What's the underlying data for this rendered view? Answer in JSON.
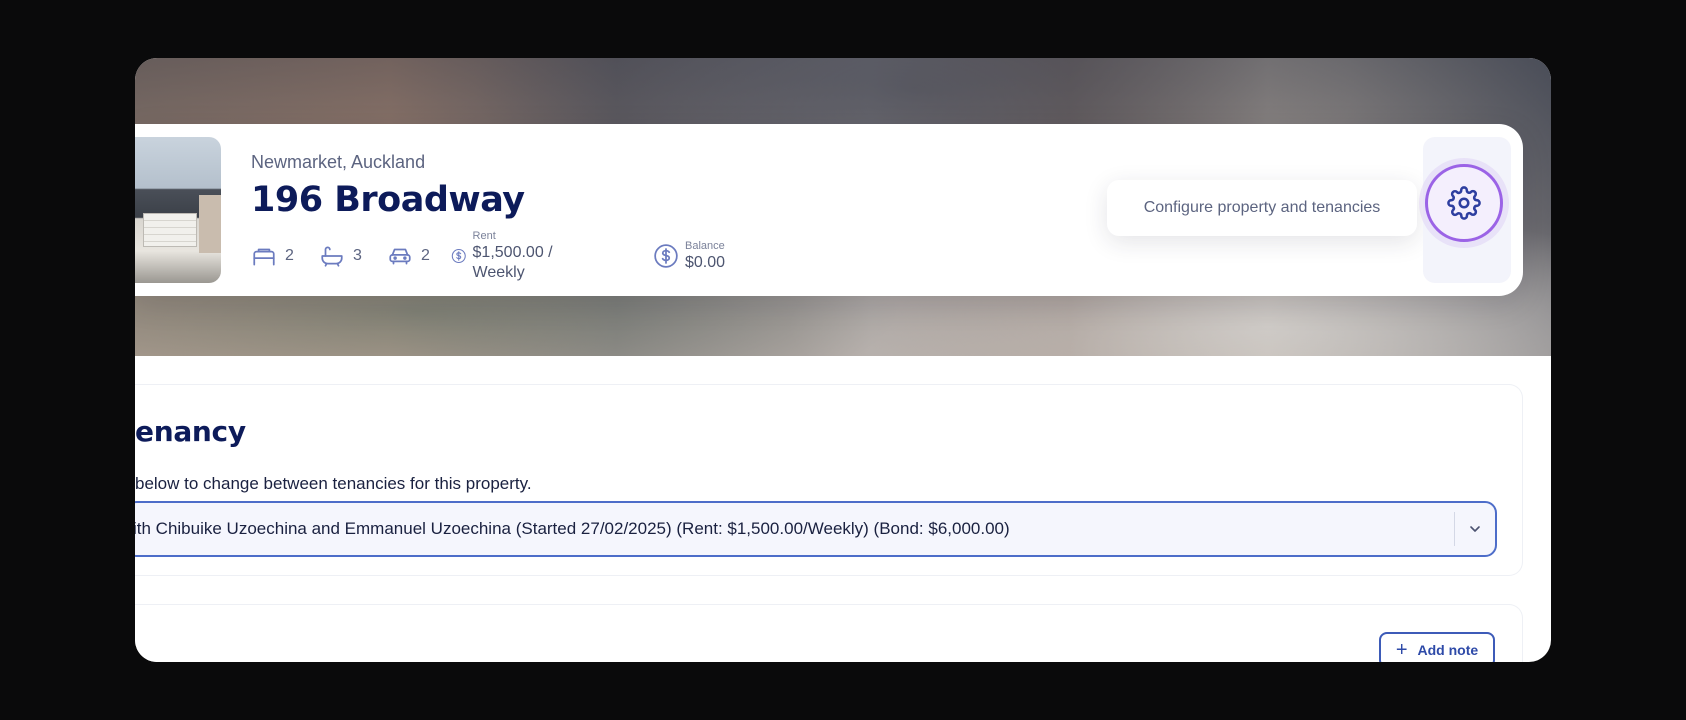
{
  "property": {
    "location": "Newmarket, Auckland",
    "title": "196 Broadway",
    "bedrooms": "2",
    "bathrooms": "3",
    "parking": "2",
    "rent_label": "Rent",
    "rent_value": "$1,500.00 / Weekly",
    "balance_label": "Balance",
    "balance_value": "$0.00"
  },
  "actions": {
    "configure_tooltip": "Configure property and tenancies",
    "configure_icon": "gear-icon"
  },
  "tenancy": {
    "heading": "enancy",
    "description": "below to change between tenancies for this property.",
    "selected": "ith Chibuike Uzoechina and Emmanuel Uzoechina (Started 27/02/2025) (Rent: $1,500.00/Weekly) (Bond: $6,000.00)"
  },
  "notes": {
    "add_label": "Add note"
  },
  "colors": {
    "brand_navy": "#0d1b5a",
    "accent_blue": "#4d6dc9",
    "highlight_purple": "#9b63e6"
  }
}
